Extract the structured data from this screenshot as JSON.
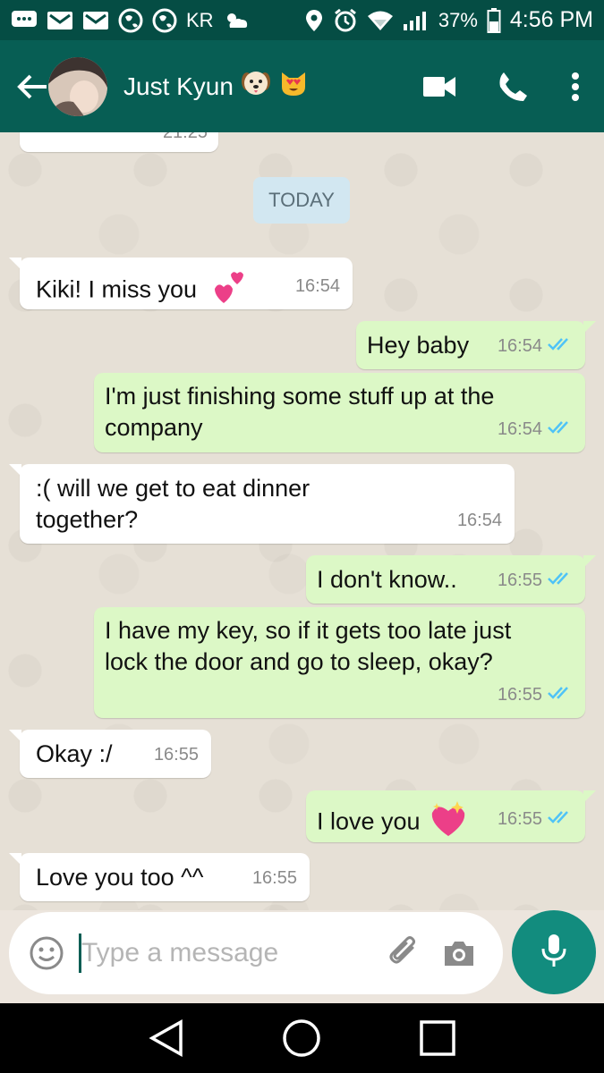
{
  "status_bar": {
    "carrier": "KR",
    "battery": "37%",
    "time": "4:56 PM"
  },
  "header": {
    "contact_name": "Just Kyun",
    "contact_emojis": [
      "dog-face-emoji",
      "heart-eyes-cat-emoji"
    ],
    "icons": [
      "back-arrow-icon",
      "video-call-icon",
      "phone-icon",
      "more-vertical-icon"
    ]
  },
  "chat": {
    "date_divider": "TODAY",
    "partial_time": "21:25",
    "messages": [
      {
        "dir": "in",
        "text": "Kiki! I miss you",
        "emoji": "two-hearts-emoji",
        "time": "16:54"
      },
      {
        "dir": "out",
        "text": "Hey baby",
        "time": "16:54"
      },
      {
        "dir": "out",
        "text": "I'm just finishing some stuff up at the company",
        "time": "16:54"
      },
      {
        "dir": "in",
        "text": ":( will we get to eat dinner together?",
        "time": "16:54"
      },
      {
        "dir": "out",
        "text": "I don't know..",
        "time": "16:55"
      },
      {
        "dir": "out",
        "text": "I have my key, so if it gets too late just lock the door and go to sleep, okay?",
        "time": "16:55"
      },
      {
        "dir": "in",
        "text": "Okay :/",
        "time": "16:55"
      },
      {
        "dir": "out",
        "text": "I love you",
        "emoji": "sparkling-heart-emoji",
        "time": "16:55"
      },
      {
        "dir": "in",
        "text": "Love you too ^^",
        "time": "16:55"
      }
    ]
  },
  "composer": {
    "placeholder": "Type a message"
  },
  "colors": {
    "header": "#075e54",
    "status_bar": "#054d44",
    "outgoing_bubble": "#dcf8c6",
    "incoming_bubble": "#ffffff",
    "read_ticks": "#4fc3f7",
    "mic_button": "#128c7e"
  }
}
